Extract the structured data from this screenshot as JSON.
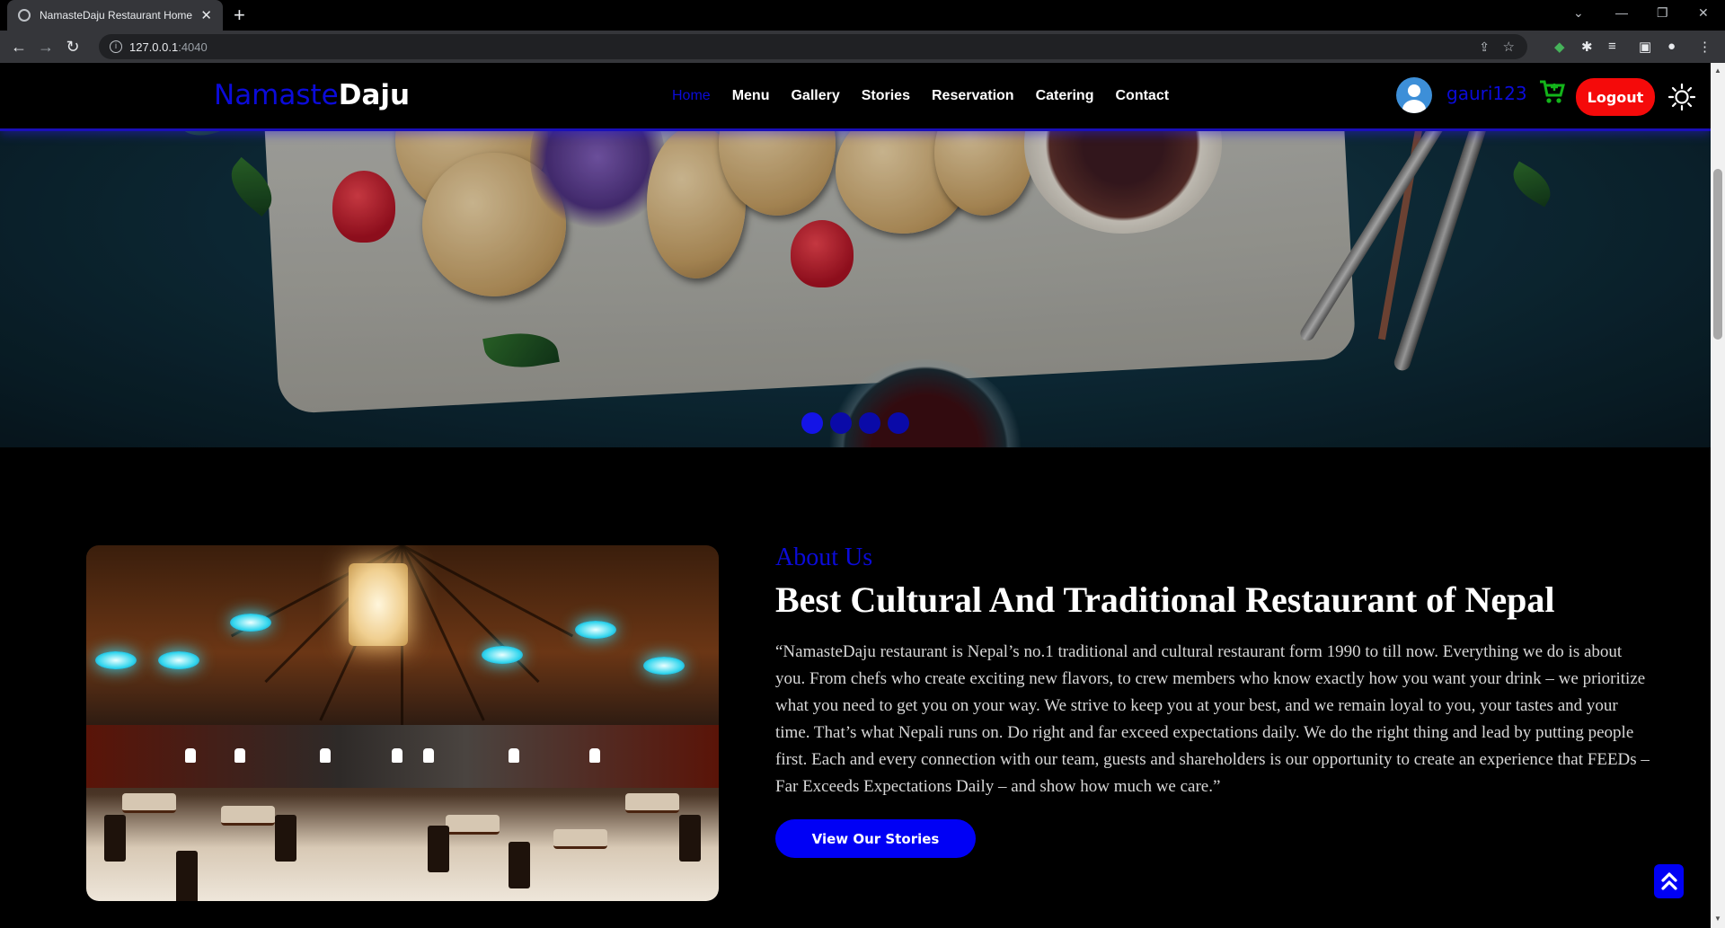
{
  "browser": {
    "tab_title": "NamasteDaju Restaurant Home",
    "url_host": "127.0.0.1",
    "url_port": ":4040"
  },
  "navbar": {
    "logo_part1": "Namaste",
    "logo_part2": "Daju",
    "links": [
      {
        "label": "Home",
        "active": true
      },
      {
        "label": "Menu"
      },
      {
        "label": "Gallery"
      },
      {
        "label": "Stories"
      },
      {
        "label": "Reservation"
      },
      {
        "label": "Catering"
      },
      {
        "label": "Contact"
      }
    ],
    "username": "gauri123",
    "logout_label": "Logout",
    "accent_color": "#0b0bd9",
    "logout_color": "#f50a0a"
  },
  "hero": {
    "slides": 4,
    "active_slide": 1
  },
  "about": {
    "kicker": "About Us",
    "title": "Best Cultural And Traditional Restaurant of Nepal",
    "text": "“NamasteDaju restaurant is Nepal’s no.1 traditional and cultural restaurant form 1990 to till now. Everything we do is about you. From chefs who create exciting new flavors, to crew members who know exactly how you want your drink – we prioritize what you need to get you on your way. We strive to keep you at your best, and we remain loyal to you, your tastes and your time. That’s what Nepali runs on. Do right and far exceed expectations daily. We do the right thing and lead by putting people first. Each and every connection with our team, guests and shareholders is our opportunity to create an experience that FEEDs – Far Exceeds Expectations Daily – and show how much we care.”",
    "button_label": "View Our Stories"
  }
}
